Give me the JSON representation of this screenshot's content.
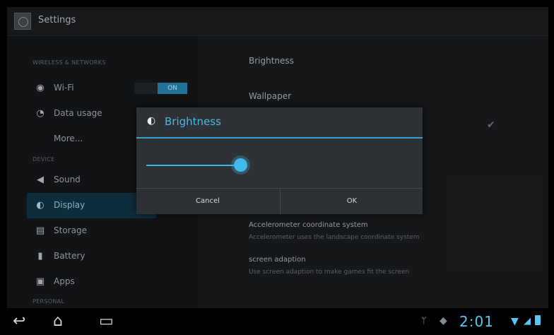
{
  "app": {
    "title": "Settings"
  },
  "sidebar": {
    "sections": [
      {
        "label": "WIRELESS & NETWORKS"
      },
      {
        "label": "DEVICE"
      },
      {
        "label": "PERSONAL"
      }
    ],
    "items": [
      {
        "label": "Wi-Fi",
        "icon": "wifi-icon"
      },
      {
        "label": "Data usage",
        "icon": "data-usage-icon"
      },
      {
        "label": "More...",
        "icon": ""
      },
      {
        "label": "Sound",
        "icon": "sound-icon"
      },
      {
        "label": "Display",
        "icon": "display-icon",
        "selected": true
      },
      {
        "label": "Storage",
        "icon": "storage-icon"
      },
      {
        "label": "Battery",
        "icon": "battery-icon"
      },
      {
        "label": "Apps",
        "icon": "apps-icon"
      }
    ],
    "wifi_toggle": "ON"
  },
  "content": {
    "items": [
      {
        "title": "Brightness"
      },
      {
        "title": "Wallpaper"
      },
      {
        "title": "Accelerometer coordinate system",
        "summary": "Accelerometer uses the landscape coordinate system"
      },
      {
        "title": "screen adaption",
        "summary": "Use screen adaption to make games fit the screen"
      }
    ]
  },
  "dialog": {
    "title": "Brightness",
    "icon": "brightness-icon",
    "slider_value_percent": 55,
    "cancel_label": "Cancel",
    "ok_label": "OK"
  },
  "statusbar": {
    "time": "2:01",
    "icons": [
      "usb-icon",
      "android-icon",
      "wifi-icon",
      "signal-icon",
      "battery-icon"
    ]
  },
  "colors": {
    "accent": "#33a2cf",
    "clock": "#56c6f2",
    "selected_bg": "#12384a"
  }
}
